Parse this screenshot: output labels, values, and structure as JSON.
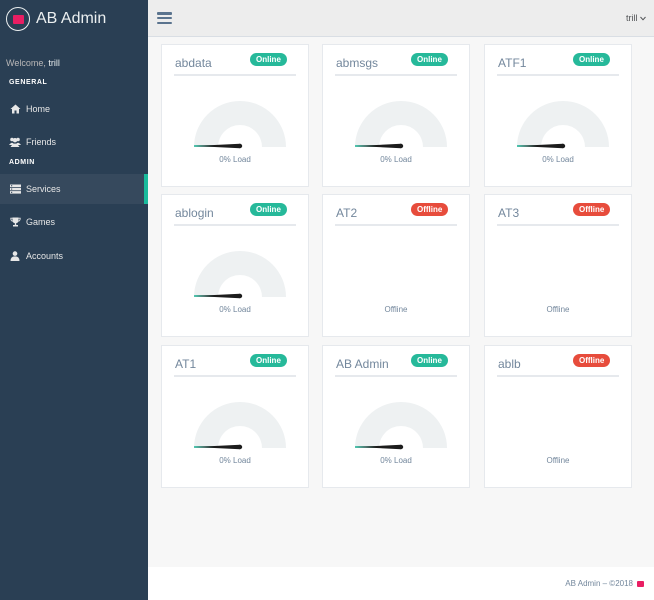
{
  "brand": {
    "title": "AB Admin"
  },
  "sidebar": {
    "welcome_prefix": "Welcome,",
    "welcome_user": "trill",
    "general_title": "GENERAL",
    "admin_title": "ADMIN",
    "items": [
      {
        "label": "Home",
        "icon": "home-icon"
      },
      {
        "label": "Friends",
        "icon": "users-icon"
      },
      {
        "label": "Services",
        "icon": "server-icon",
        "active": true
      },
      {
        "label": "Games",
        "icon": "trophy-icon"
      },
      {
        "label": "Accounts",
        "icon": "user-icon"
      }
    ]
  },
  "topbar": {
    "user": "trill"
  },
  "services": [
    {
      "name": "abdata",
      "status": "Online",
      "load_text": "0% Load",
      "load": 0
    },
    {
      "name": "abmsgs",
      "status": "Online",
      "load_text": "0% Load",
      "load": 0
    },
    {
      "name": "ATF1",
      "status": "Online",
      "load_text": "0% Load",
      "load": 0
    },
    {
      "name": "ablogin",
      "status": "Online",
      "load_text": "0% Load",
      "load": 0
    },
    {
      "name": "AT2",
      "status": "Offline",
      "load_text": "Offline"
    },
    {
      "name": "AT3",
      "status": "Offline",
      "load_text": "Offline"
    },
    {
      "name": "AT1",
      "status": "Online",
      "load_text": "0% Load",
      "load": 0
    },
    {
      "name": "AB Admin",
      "status": "Online",
      "load_text": "0% Load",
      "load": 0
    },
    {
      "name": "ablb",
      "status": "Offline",
      "load_text": "Offline"
    }
  ],
  "colors": {
    "online": "#26b99a",
    "offline": "#e74c3c",
    "sidebar": "#2a3f54",
    "brand_accent": "#e91e63"
  },
  "footer": {
    "text": "AB Admin – ©2018"
  }
}
